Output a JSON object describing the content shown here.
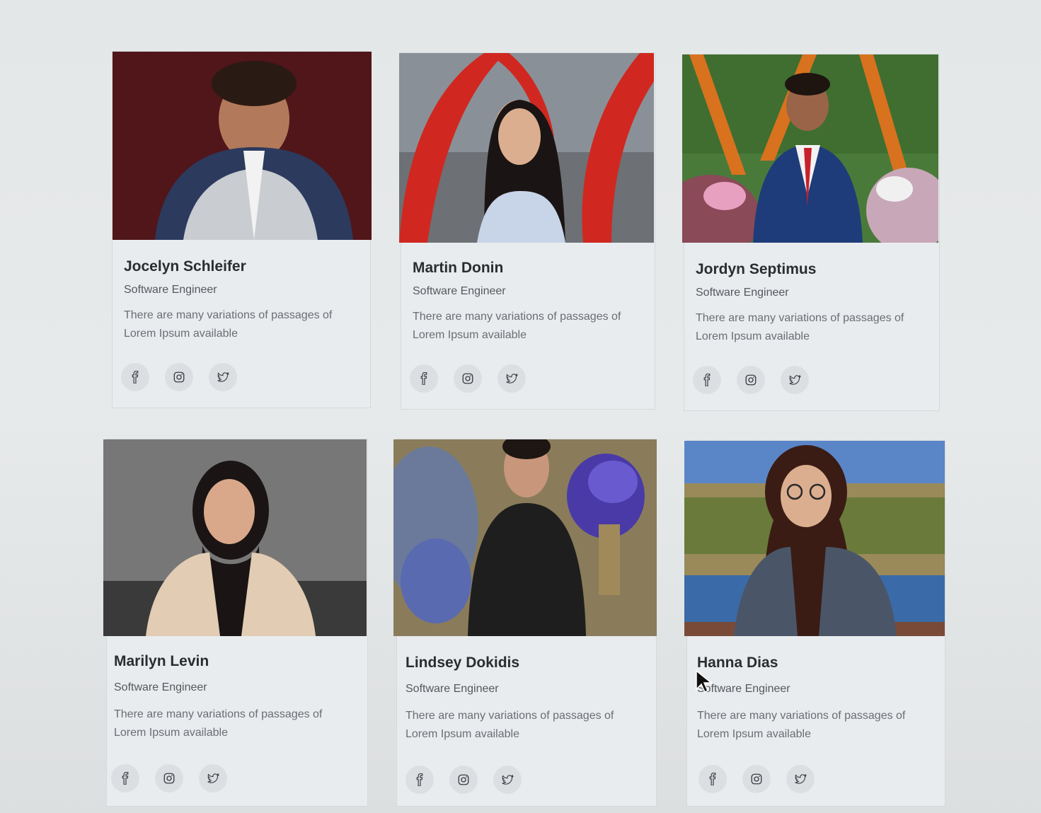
{
  "team": [
    {
      "name": "Jocelyn Schleifer",
      "role": "Software Engineer",
      "description": "There are many variations of passages of Lorem Ipsum available"
    },
    {
      "name": "Martin Donin",
      "role": "Software Engineer",
      "description": "There are many variations of passages of Lorem Ipsum available"
    },
    {
      "name": "Jordyn Septimus",
      "role": "Software Engineer",
      "description": "There are many variations of passages of Lorem Ipsum available"
    },
    {
      "name": "Marilyn Levin",
      "role": "Software Engineer",
      "description": "There are many variations of passages of Lorem Ipsum available"
    },
    {
      "name": "Lindsey Dokidis",
      "role": "Software Engineer",
      "description": "There are many variations of passages of Lorem Ipsum available"
    },
    {
      "name": "Hanna Dias",
      "role": "Software Engineer",
      "description": "There are many variations of passages of Lorem Ipsum available"
    }
  ],
  "social_icons": [
    "facebook-icon",
    "instagram-icon",
    "twitter-icon"
  ],
  "colors": {
    "card_bg": "#e9ecee",
    "name_text": "#2a2d30",
    "muted_text": "#6a6e73",
    "social_bg": "#dcdfe2"
  }
}
